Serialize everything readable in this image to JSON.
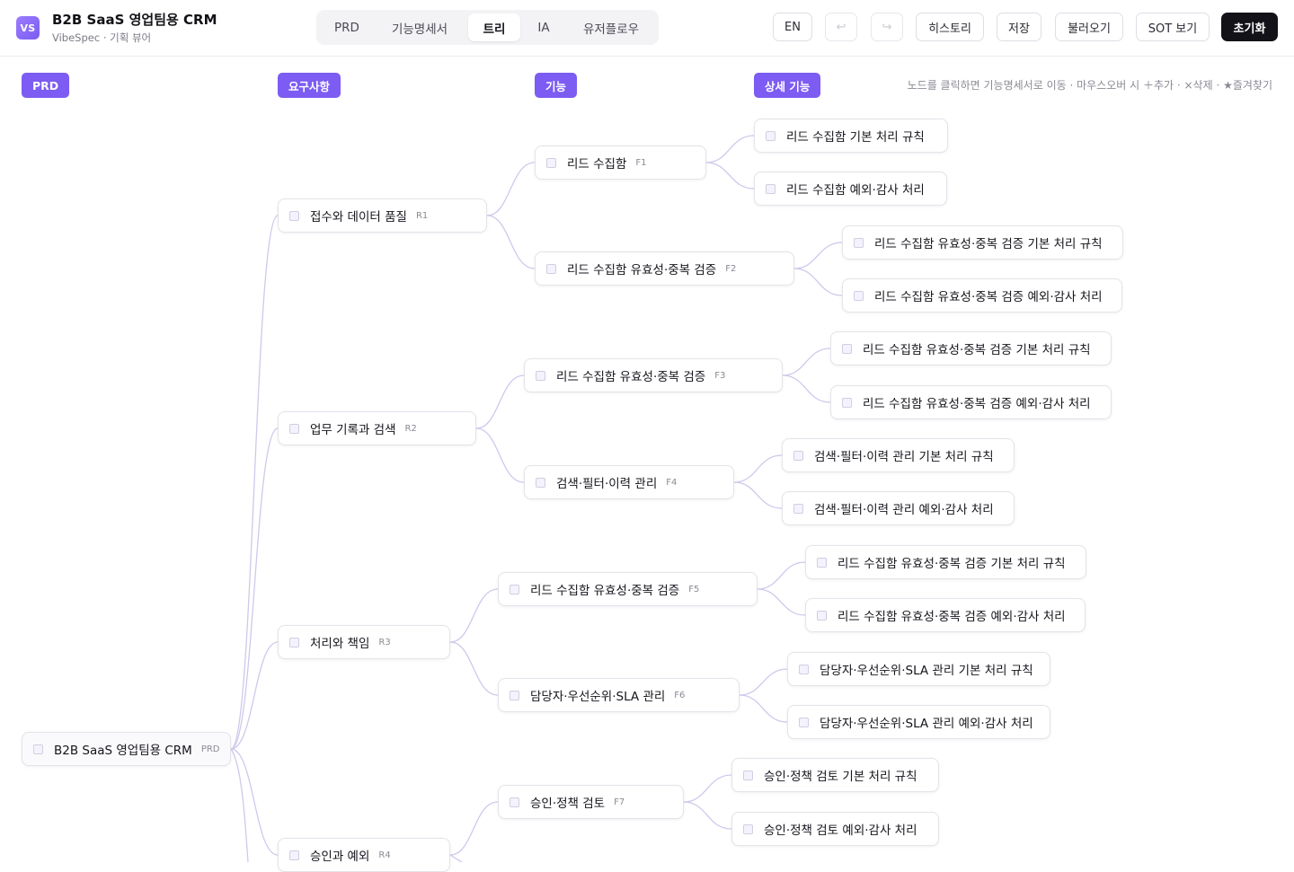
{
  "app": {
    "badge": "VS",
    "title": "B2B SaaS 영업팀용 CRM",
    "subtitle": "VibeSpec · 기획 뷰어"
  },
  "tabs": [
    {
      "label": "PRD",
      "active": false
    },
    {
      "label": "기능명세서",
      "active": false
    },
    {
      "label": "트리",
      "active": true
    },
    {
      "label": "IA",
      "active": false
    },
    {
      "label": "유저플로우",
      "active": false
    }
  ],
  "actions": {
    "lang": "EN",
    "undo": "↩",
    "redo": "↪",
    "history": "히스토리",
    "save": "저장",
    "load": "불러오기",
    "sot": "SOT 보기",
    "reset": "초기화"
  },
  "columns": {
    "prd": "PRD",
    "req": "요구사항",
    "feat": "기능",
    "detail": "상세 기능"
  },
  "hint": "노드를 클릭하면 기능명세서로 이동 · 마우스오버 시 ＋추가 · ×삭제 · ★즐겨찾기",
  "tree": {
    "root": {
      "label": "B2B SaaS 영업팀용 CRM",
      "code": "PRD"
    },
    "requirements": [
      {
        "label": "접수와 데이터 품질",
        "code": "R1"
      },
      {
        "label": "업무 기록과 검색",
        "code": "R2"
      },
      {
        "label": "처리와 책임",
        "code": "R3"
      },
      {
        "label": "승인과 예외",
        "code": "R4"
      }
    ],
    "features": [
      {
        "label": "리드 수집함",
        "code": "F1"
      },
      {
        "label": "리드 수집함 유효성·중복 검증",
        "code": "F2"
      },
      {
        "label": "리드 수집함 유효성·중복 검증",
        "code": "F3"
      },
      {
        "label": "검색·필터·이력 관리",
        "code": "F4"
      },
      {
        "label": "리드 수집함 유효성·중복 검증",
        "code": "F5"
      },
      {
        "label": "담당자·우선순위·SLA 관리",
        "code": "F6"
      },
      {
        "label": "승인·정책 검토",
        "code": "F7"
      }
    ],
    "details": [
      "리드 수집함 기본 처리 규칙",
      "리드 수집함 예외·감사 처리",
      "리드 수집함 유효성·중복 검증 기본 처리 규칙",
      "리드 수집함 유효성·중복 검증 예외·감사 처리",
      "리드 수집함 유효성·중복 검증 기본 처리 규칙",
      "리드 수집함 유효성·중복 검증 예외·감사 처리",
      "검색·필터·이력 관리 기본 처리 규칙",
      "검색·필터·이력 관리 예외·감사 처리",
      "리드 수집함 유효성·중복 검증 기본 처리 규칙",
      "리드 수집함 유효성·중복 검증 예외·감사 처리",
      "담당자·우선순위·SLA 관리 기본 처리 규칙",
      "담당자·우선순위·SLA 관리 예외·감사 처리",
      "승인·정책 검토 기본 처리 규칙",
      "승인·정책 검토 예외·감사 처리"
    ]
  }
}
